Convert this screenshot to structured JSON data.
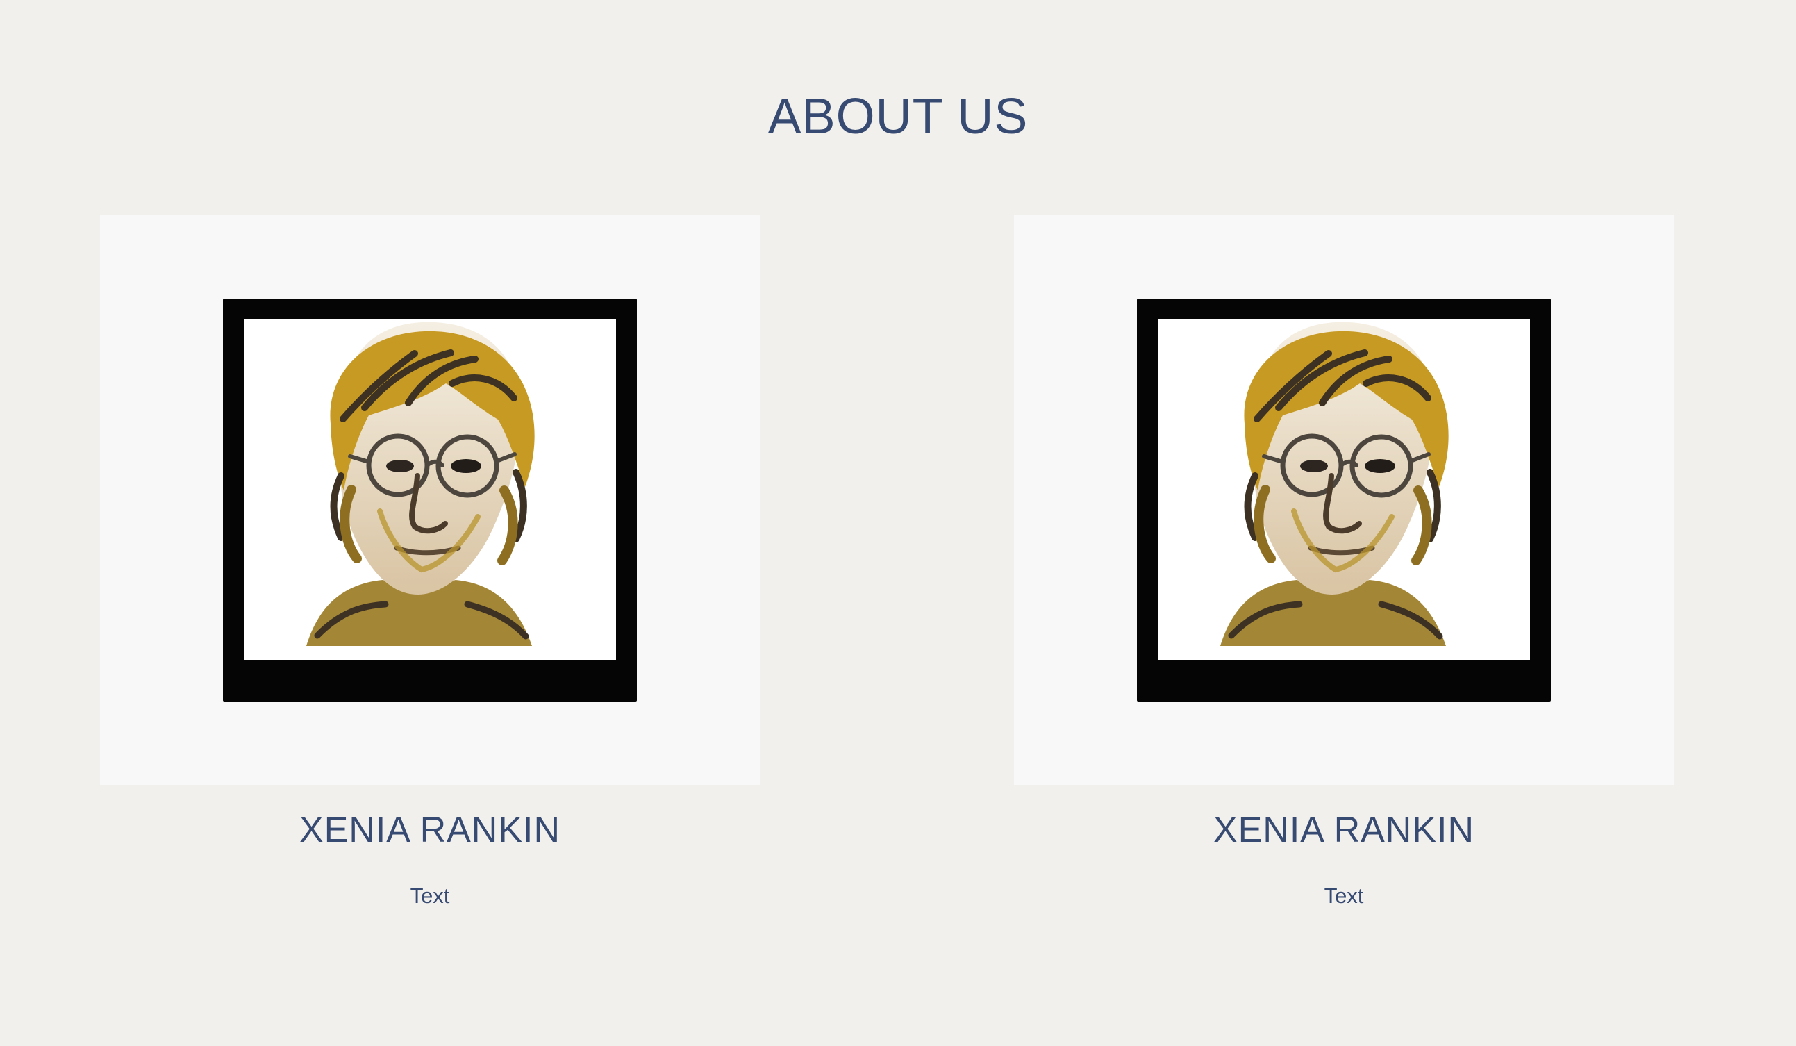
{
  "header": {
    "title": "ABOUT US"
  },
  "team": [
    {
      "name": "XENIA RANKIN",
      "text": "Text",
      "portrait_icon": "portrait-illustration-icon"
    },
    {
      "name": "XENIA RANKIN",
      "text": "Text",
      "portrait_icon": "portrait-illustration-icon"
    }
  ],
  "colors": {
    "background": "#f2f0ec",
    "card": "#f8f8f8",
    "heading": "#364a72",
    "frame": "#050505",
    "gold": "#c79a24"
  }
}
